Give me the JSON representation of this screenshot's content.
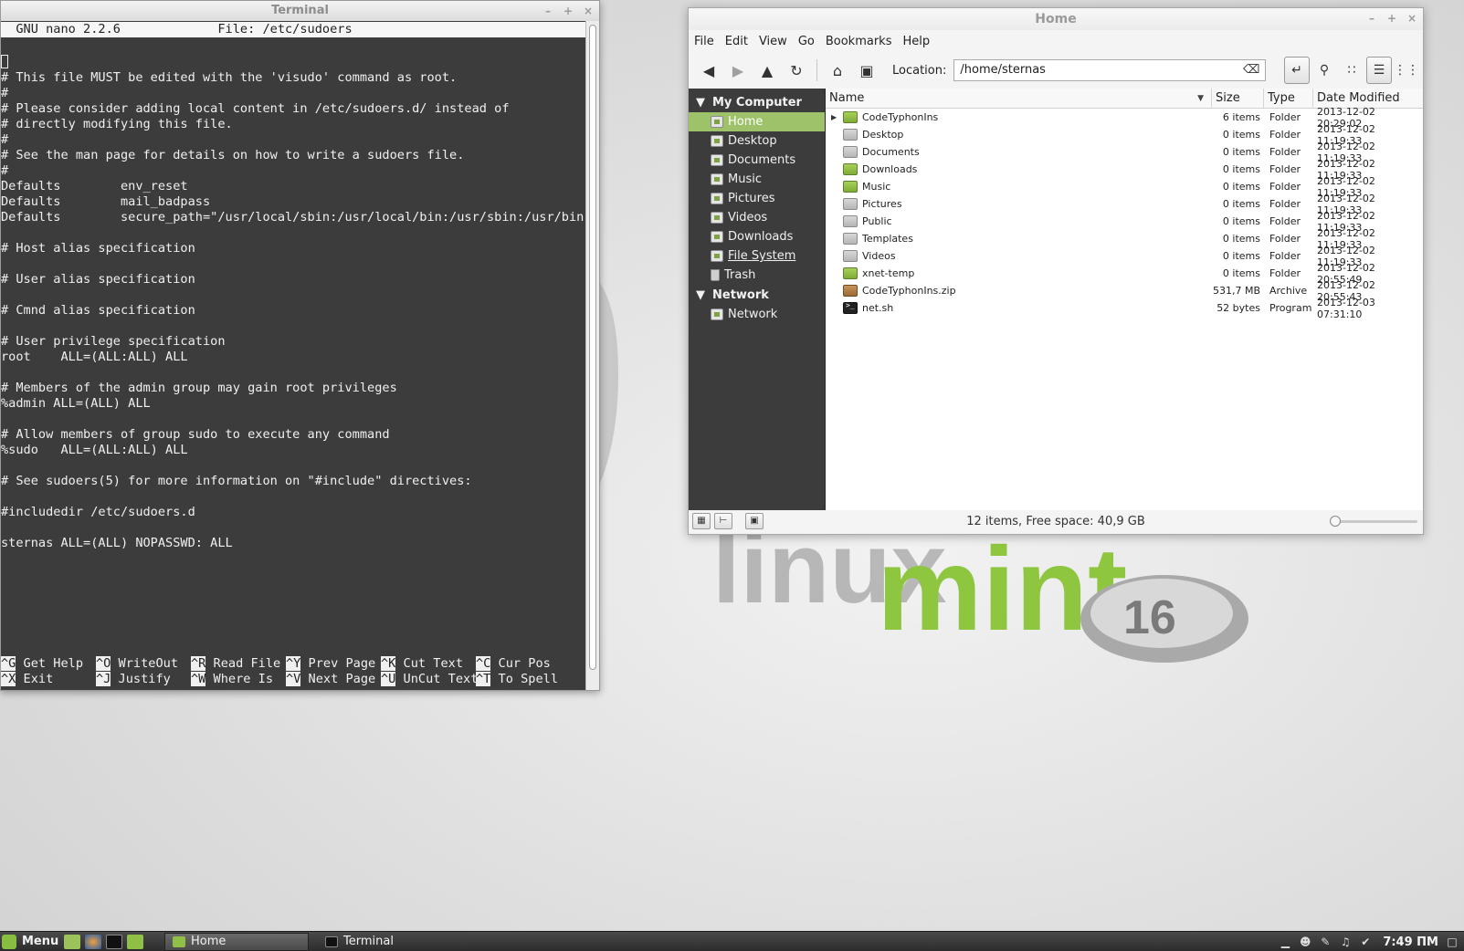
{
  "terminal": {
    "title": "Terminal",
    "nano_header": "  GNU nano 2.2.6             File: /etc/sudoers",
    "lines": [
      "",
      "#",
      "# This file MUST be edited with the 'visudo' command as root.",
      "#",
      "# Please consider adding local content in /etc/sudoers.d/ instead of",
      "# directly modifying this file.",
      "#",
      "# See the man page for details on how to write a sudoers file.",
      "#",
      "Defaults        env_reset",
      "Defaults        mail_badpass",
      "Defaults        secure_path=\"/usr/local/sbin:/usr/local/bin:/usr/sbin:/usr/bin:$",
      "",
      "# Host alias specification",
      "",
      "# User alias specification",
      "",
      "# Cmnd alias specification",
      "",
      "# User privilege specification",
      "root    ALL=(ALL:ALL) ALL",
      "",
      "# Members of the admin group may gain root privileges",
      "%admin ALL=(ALL) ALL",
      "",
      "# Allow members of group sudo to execute any command",
      "%sudo   ALL=(ALL:ALL) ALL",
      "",
      "# See sudoers(5) for more information on \"#include\" directives:",
      "",
      "#includedir /etc/sudoers.d",
      "",
      "sternas ALL=(ALL) NOPASSWD: ALL"
    ],
    "shortcuts_row1": [
      {
        "key": "^G",
        "label": " Get Help"
      },
      {
        "key": "^O",
        "label": " WriteOut"
      },
      {
        "key": "^R",
        "label": " Read File"
      },
      {
        "key": "^Y",
        "label": " Prev Page"
      },
      {
        "key": "^K",
        "label": " Cut Text"
      },
      {
        "key": "^C",
        "label": " Cur Pos"
      }
    ],
    "shortcuts_row2": [
      {
        "key": "^X",
        "label": " Exit"
      },
      {
        "key": "^J",
        "label": " Justify"
      },
      {
        "key": "^W",
        "label": " Where Is"
      },
      {
        "key": "^V",
        "label": " Next Page"
      },
      {
        "key": "^U",
        "label": " UnCut Text"
      },
      {
        "key": "^T",
        "label": " To Spell"
      }
    ]
  },
  "filemanager": {
    "title": "Home",
    "menu": [
      "File",
      "Edit",
      "View",
      "Go",
      "Bookmarks",
      "Help"
    ],
    "location_label": "Location:",
    "location_value": "/home/sternas",
    "sidebar": {
      "computer_label": "My Computer",
      "computer_items": [
        "Home",
        "Desktop",
        "Documents",
        "Music",
        "Pictures",
        "Videos",
        "Downloads",
        "File System",
        "Trash"
      ],
      "network_label": "Network",
      "network_items": [
        "Network"
      ]
    },
    "columns": [
      "Name",
      "Size",
      "Type",
      "Date Modified"
    ],
    "files": [
      {
        "name": "CodeTyphonIns",
        "size": "6 items",
        "type": "Folder",
        "date": "2013-12-02 20:29:02",
        "icon": "folder-icon"
      },
      {
        "name": "Desktop",
        "size": "0 items",
        "type": "Folder",
        "date": "2013-12-02 11:19:33",
        "icon": "desktop-folder-icon"
      },
      {
        "name": "Documents",
        "size": "0 items",
        "type": "Folder",
        "date": "2013-12-02 11:19:33",
        "icon": "documents-folder-icon"
      },
      {
        "name": "Downloads",
        "size": "0 items",
        "type": "Folder",
        "date": "2013-12-02 11:19:33",
        "icon": "downloads-folder-icon"
      },
      {
        "name": "Music",
        "size": "0 items",
        "type": "Folder",
        "date": "2013-12-02 11:19:33",
        "icon": "music-folder-icon"
      },
      {
        "name": "Pictures",
        "size": "0 items",
        "type": "Folder",
        "date": "2013-12-02 11:19:33",
        "icon": "pictures-folder-icon"
      },
      {
        "name": "Public",
        "size": "0 items",
        "type": "Folder",
        "date": "2013-12-02 11:19:33",
        "icon": "public-folder-icon"
      },
      {
        "name": "Templates",
        "size": "0 items",
        "type": "Folder",
        "date": "2013-12-02 11:19:33",
        "icon": "templates-folder-icon"
      },
      {
        "name": "Videos",
        "size": "0 items",
        "type": "Folder",
        "date": "2013-12-02 11:19:33",
        "icon": "videos-folder-icon"
      },
      {
        "name": "xnet-temp",
        "size": "0 items",
        "type": "Folder",
        "date": "2013-12-02 20:55:49",
        "icon": "folder-icon"
      },
      {
        "name": "CodeTyphonIns.zip",
        "size": "531,7 MB",
        "type": "Archive",
        "date": "2013-12-02 20:55:43",
        "icon": "archive-icon"
      },
      {
        "name": "net.sh",
        "size": "52 bytes",
        "type": "Program",
        "date": "2013-12-03 07:31:10",
        "icon": "terminal-script-icon"
      }
    ],
    "status_text": "12 items, Free space: 40,9 GB",
    "zoom_level": 0.0
  },
  "wallpaper": {
    "brand_text": "linux",
    "brand_text2": "mint",
    "version": "16"
  },
  "taskbar": {
    "menu_label": "Menu",
    "tasks": [
      "Home",
      "Terminal"
    ],
    "clock": "7:49 ПМ"
  },
  "colors": {
    "mint_green": "#87be3f",
    "sidebar_selected": "#9ec26a",
    "terminal_bg": "#3c3c3c"
  }
}
